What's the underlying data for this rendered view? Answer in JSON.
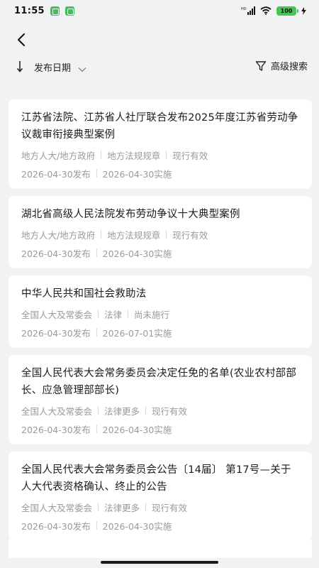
{
  "status_bar": {
    "time": "11:55",
    "network": "HD",
    "battery": "100"
  },
  "nav": {
    "back_icon": "chevron-left-icon"
  },
  "filters": {
    "sort_label": "发布日期",
    "advanced_search_label": "高级搜索"
  },
  "items": [
    {
      "title": "江苏省法院、江苏省人社厅联合发布2025年度江苏省劳动争议裁审衔接典型案例",
      "tags": [
        "地方人大/地方政府",
        "地方法规规章",
        "现行有效"
      ],
      "published": "2026-04-30发布",
      "effective": "2026-04-30实施"
    },
    {
      "title": "湖北省高级人民法院发布劳动争议十大典型案例",
      "tags": [
        "地方人大/地方政府",
        "地方法规规章",
        "现行有效"
      ],
      "published": "2026-04-30发布",
      "effective": "2026-04-30实施"
    },
    {
      "title": "中华人民共和国社会救助法",
      "tags": [
        "全国人大及常委会",
        "法律",
        "尚未施行"
      ],
      "published": "2026-04-30发布",
      "effective": "2026-07-01实施"
    },
    {
      "title": "全国人民代表大会常务委员会决定任免的名单(农业农村部部长、应急管理部部长)",
      "tags": [
        "全国人大及常委会",
        "法律更多",
        "现行有效"
      ],
      "published": "2026-04-30发布",
      "effective": "2026-04-30实施"
    },
    {
      "title": "全国人民代表大会常务委员会公告〔14届〕 第17号—关于人大代表资格确认、终止的公告",
      "tags": [
        "全国人大及常委会",
        "法律更多",
        "现行有效"
      ],
      "published": "2026-04-30发布",
      "effective": "2026-04-30实施"
    }
  ]
}
